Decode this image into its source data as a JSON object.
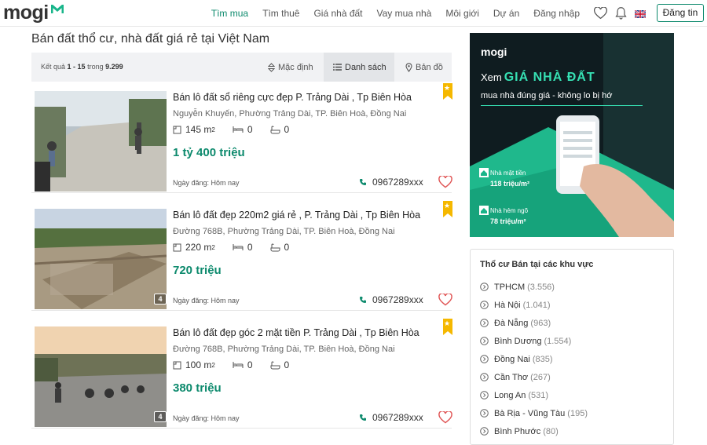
{
  "header": {
    "logo_text": "mogi",
    "nav": [
      "Tìm mua",
      "Tìm thuê",
      "Giá nhà đất",
      "Vay mua nhà",
      "Môi giới",
      "Dự án",
      "Đăng nhập"
    ],
    "post_button": "Đăng tin",
    "accent": "#0d8a6d"
  },
  "page": {
    "title": "Bán đất thổ cư, nhà đất giá rẻ tại Việt Nam",
    "result_prefix": "Kết quả",
    "result_range": "1 - 15",
    "result_mid": "trong",
    "result_total": "9.299",
    "sort_label": "Mặc định",
    "list_label": "Danh sách",
    "map_label": "Bản đồ"
  },
  "listings": [
    {
      "title": "Bán lô đất sổ riêng cực đẹp P. Trảng Dài , Tp Biên Hòa",
      "address": "Nguyễn Khuyến, Phường Trảng Dài, TP. Biên Hoà, Đồng Nai",
      "area": "145 m",
      "bed": "0",
      "bath": "0",
      "price": "1 tỷ 400 triệu",
      "date": "Ngày đăng: Hôm nay",
      "phone": "0967289xxx",
      "img_count": ""
    },
    {
      "title": "Bán lô đất đẹp 220m2 giá rẻ , P. Trảng Dài , Tp Biên Hòa",
      "address": "Đường 768B, Phường Trảng Dài, TP. Biên Hoà, Đồng Nai",
      "area": "220 m",
      "bed": "0",
      "bath": "0",
      "price": "720 triệu",
      "date": "Ngày đăng: Hôm nay",
      "phone": "0967289xxx",
      "img_count": "4"
    },
    {
      "title": "Bán lô đất đẹp góc 2 mặt tiền P. Trảng Dài , Tp Biên Hòa",
      "address": "Đường 768B, Phường Trảng Dài, TP. Biên Hoà, Đồng Nai",
      "area": "100 m",
      "bed": "0",
      "bath": "0",
      "price": "380 triệu",
      "date": "Ngày đăng: Hôm nay",
      "phone": "0967289xxx",
      "img_count": "4"
    }
  ],
  "ad": {
    "logo": "mogi",
    "line1_prefix": "Xem",
    "line1_highlight": "GIÁ NHÀ ĐẤT",
    "line2": "mua nhà đúng giá - không lo bị hớ",
    "card1_label": "Nhà mặt tiền",
    "card1_price": "118 triệu/m²",
    "card2_label": "Nhà hẻm ngõ",
    "card2_price": "78 triệu/m²"
  },
  "regions": {
    "title": "Thổ cư Bán tại các khu vực",
    "items": [
      {
        "name": "TPHCM",
        "count": "(3.556)"
      },
      {
        "name": "Hà Nội",
        "count": "(1.041)"
      },
      {
        "name": "Đà Nẵng",
        "count": "(963)"
      },
      {
        "name": "Bình Dương",
        "count": "(1.554)"
      },
      {
        "name": "Đồng Nai",
        "count": "(835)"
      },
      {
        "name": "Cần Thơ",
        "count": "(267)"
      },
      {
        "name": "Long An",
        "count": "(531)"
      },
      {
        "name": "Bà Rịa - Vũng Tàu",
        "count": "(195)"
      },
      {
        "name": "Bình Phước",
        "count": "(80)"
      }
    ]
  }
}
